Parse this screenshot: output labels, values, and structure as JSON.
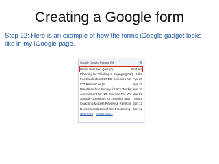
{
  "slide": {
    "title": "Creating a Google form",
    "step_text": "Step 22: Here is an example of how the forms iGoogle gadget looks like in my iGoogle page."
  },
  "gadget": {
    "title": "Google Docs to Reclaim Bill",
    "menu_icon": "gear-icon",
    "forms": [
      {
        "name": "Water Pollution Quiz (0)",
        "date": "9:03 am",
        "highlighted": true
      },
      {
        "name": "Planning for Thinking & Engaging NZ)",
        "date": "Jul 8"
      },
      {
        "name": "Feedback about CPDD Sciences Ne",
        "date": "Apr 26"
      },
      {
        "name": "ICT Resources (2)",
        "date": "Apr 19"
      },
      {
        "name": "Pre-Workshop Survey for ICT Workst",
        "date": "Apr 16"
      },
      {
        "name": "Assessment for NZ) Science Pre-Wc",
        "date": "Mar 29"
      },
      {
        "name": "Sample Questions for LMS like appr",
        "date": "Mar 8"
      },
      {
        "name": "Coaching Models Review & Reflectio",
        "date": "Jan 12"
      },
      {
        "name": "Recommendation of the 4 Coaching I",
        "date": "Jan 12"
      }
    ],
    "footer": {
      "new_form": "New form",
      "show_less": "Show less..."
    }
  },
  "colors": {
    "step_text": "#1f56a0",
    "highlight": "#d42626",
    "link": "#2a5db0"
  }
}
